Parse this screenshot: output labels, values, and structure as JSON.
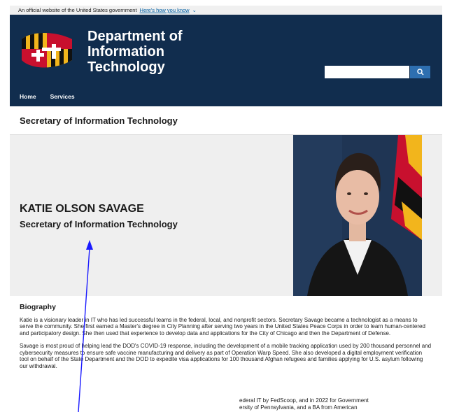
{
  "gov_banner": {
    "text": "An official website of the United States government",
    "link": "Here's how you know",
    "chevron": "chevron-down-icon"
  },
  "header": {
    "brand_line1": "Department of",
    "brand_line2": "Information",
    "brand_line3": "Technology",
    "search_placeholder": "",
    "search_icon": "search-icon"
  },
  "nav": {
    "items": [
      "Home",
      "Services"
    ]
  },
  "page": {
    "title": "Secretary of Information Technology"
  },
  "hero": {
    "name": "KATIE OLSON SAVAGE",
    "subtitle": "Secretary of Information Technology"
  },
  "bio": {
    "heading": "Biography",
    "p1": "Katie is a visionary leader in IT who has led successful teams in the federal, local, and nonprofit sectors. Secretary Savage became a technologist as a means to serve the community. She first earned a Master's degree in City Planning after serving two years in the United States Peace Corps in order to learn human-centered and participatory design. She then used that experience to develop data and applications for the City of Chicago and then the Department of Defense.",
    "p2": "Savage is most proud of helping lead the DOD's COVID-19 response, including the development of a mobile tracking application used by 200 thousand personnel and cybersecurity measures to ensure safe vaccine manufacturing and delivery as part of Operation Warp Speed. She also developed a digital employment verification tool on behalf of the State Department and the DOD to expedite visa applications for 100 thousand Afghan refugees and families applying for U.S. asylum following our withdrawal.",
    "partial_line1": "ederal IT by FedScoop, and in 2022 for Government",
    "partial_line2": "ersity of Pennsylvania, and a BA from American"
  },
  "colors": {
    "header_bg": "#112d4e",
    "search_btn": "#2e6fb0",
    "hero_bg": "#efefef",
    "pointer": "#1a1aff"
  }
}
